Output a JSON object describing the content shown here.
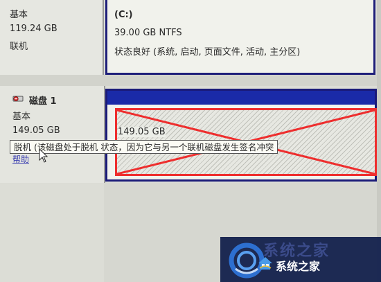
{
  "disk0": {
    "type": "基本",
    "size": "119.24 GB",
    "status": "联机",
    "partition": {
      "label": "(C:)",
      "size_fs": "39.00 GB NTFS",
      "health": "状态良好 (系统, 启动, 页面文件, 活动, 主分区)"
    }
  },
  "disk1": {
    "title": "磁盘 1",
    "type": "基本",
    "size": "149.05 GB",
    "help_link": "帮助",
    "partition_size": "149.05 GB",
    "tooltip": "脱机 (该磁盘处于脱机 状态，因为它与另一个联机磁盘发生签名冲突"
  },
  "watermark": {
    "brand_faint": "系统之家",
    "brand": "系统之家"
  },
  "colors": {
    "bar_blue": "#1a2aa8",
    "highlight_red": "#ee2e2e",
    "watermark_bg": "#15224e"
  },
  "icons": [
    "disk-offline-icon",
    "mouse-cursor-icon",
    "watermark-logo-icon",
    "house-logo-icon"
  ]
}
